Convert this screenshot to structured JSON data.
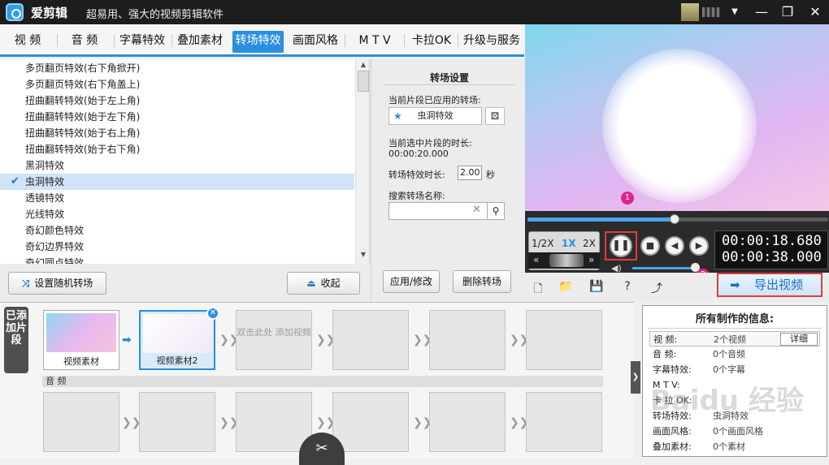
{
  "app": {
    "name": "爱剪辑",
    "slogan": "超易用、强大的视频剪辑软件"
  },
  "tabs": [
    "视 频",
    "音 频",
    "字幕特效",
    "叠加素材",
    "转场特效",
    "画面风格",
    "M T V",
    "卡拉OK",
    "升级与服务"
  ],
  "active_tab": "转场特效",
  "transitions": [
    "多页翻页特效(右下角掀开)",
    "多页翻页特效(右下角盖上)",
    "扭曲翻转特效(始于左上角)",
    "扭曲翻转特效(始于左下角)",
    "扭曲翻转特效(始于右上角)",
    "扭曲翻转特效(始于右下角)",
    "黑洞特效",
    "虫洞特效",
    "透镜特效",
    "光线特效",
    "奇幻颜色特效",
    "奇幻边界特效",
    "奇幻圆点特效"
  ],
  "selected_transition": "虫洞特效",
  "left_buttons": {
    "random": "设置随机转场",
    "collapse": "收起"
  },
  "settings": {
    "title": "转场设置",
    "applied_label": "当前片段已应用的转场:",
    "applied_value": "虫洞特效",
    "duration_label": "当前选中片段的时长:",
    "duration_value": "00:00:20.000",
    "effect_duration_label": "转场特效时长:",
    "effect_duration_value": "2.00",
    "effect_duration_unit": "秒",
    "search_label": "搜索转场名称:",
    "search_placeholder": "",
    "apply_button": "应用/修改",
    "delete_button": "删除转场"
  },
  "player": {
    "progress": 0.49,
    "speeds": [
      "1/2X",
      "1X",
      "2X"
    ],
    "active_speed": "1X",
    "current_time": "00:00:18.680",
    "total_time": "00:00:38.000",
    "volume": 0.9,
    "badges": [
      "1",
      "2"
    ]
  },
  "toolbar_icons": [
    "new-icon",
    "open-folder-icon",
    "save-icon",
    "help-icon",
    "share-icon"
  ],
  "export_label": "导出视频",
  "timeline": {
    "side_tab": "已添加片段",
    "clips": [
      {
        "label": "视频素材",
        "state": "filled"
      },
      {
        "label": "视频素材2",
        "state": "selected"
      },
      {
        "label": "双击此处 添加视频",
        "state": "empty"
      },
      {
        "label": "",
        "state": "empty"
      },
      {
        "label": "",
        "state": "empty"
      },
      {
        "label": "",
        "state": "empty"
      }
    ],
    "audio_label": "音 频"
  },
  "info_panel": {
    "title": "所有制作的信息:",
    "rows": [
      {
        "key": "视    频:",
        "value": "2个视频",
        "button": "详细"
      },
      {
        "key": "音    频:",
        "value": "0个音频"
      },
      {
        "key": "字幕特效:",
        "value": "0个字幕"
      },
      {
        "key": "M  T  V:",
        "value": ""
      },
      {
        "key": "卡 拉 OK:",
        "value": ""
      },
      {
        "key": "转场特效:",
        "value": "虫洞特效"
      },
      {
        "key": "画面风格:",
        "value": "0个画面风格"
      },
      {
        "key": "叠加素材:",
        "value": "0个素材"
      }
    ]
  },
  "watermark": "Baidu 经验",
  "colors": {
    "accent": "#2a8fe0",
    "highlight": "#e23b3b",
    "badge": "#e0228c"
  }
}
